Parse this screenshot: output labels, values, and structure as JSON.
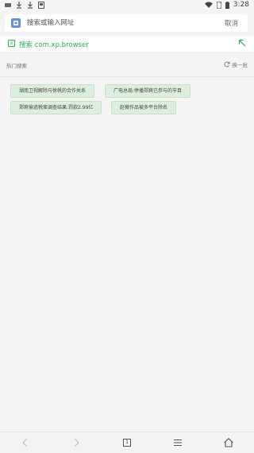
{
  "status_bar": {
    "time": "3:28"
  },
  "search": {
    "placeholder": "搜索或输入网址",
    "cancel_label": "取消"
  },
  "suggestion": {
    "text": "搜索 com.xp.browser"
  },
  "hot": {
    "title": "热门搜索",
    "refresh_label": "换一批",
    "chips": [
      "湖南卫视解除与徐帆的合作关系",
      "广电总局:停播郑爽已参与的节目",
      "郑爽偷逃税案调查结果:罚款2.99亿",
      "赵薇作品被多平台除名"
    ]
  },
  "bottom_nav": {
    "tab_count": "1"
  },
  "colors": {
    "accent": "#2fa84f",
    "chip_bg": "#dceedd",
    "background": "#f4f4f4"
  }
}
